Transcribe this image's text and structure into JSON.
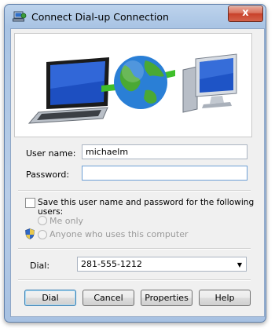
{
  "window": {
    "title": "Connect Dial-up Connection",
    "close_glyph": "x"
  },
  "form": {
    "username_label": "User name:",
    "username_value": "michaelm",
    "password_label": "Password:",
    "password_value": "",
    "save_label": "Save this user name and password for the following users:",
    "save_checked": false,
    "radio_me_only": "Me only",
    "radio_anyone": "Anyone who uses this computer",
    "dial_label": "Dial:",
    "dial_value": "281-555-1212"
  },
  "buttons": {
    "dial": "Dial",
    "cancel": "Cancel",
    "properties": "Properties",
    "help": "Help"
  },
  "icons": {
    "title": "dialup-connection-icon",
    "shield": "uac-shield-icon",
    "banner": "laptop-globe-computer-illustration"
  }
}
